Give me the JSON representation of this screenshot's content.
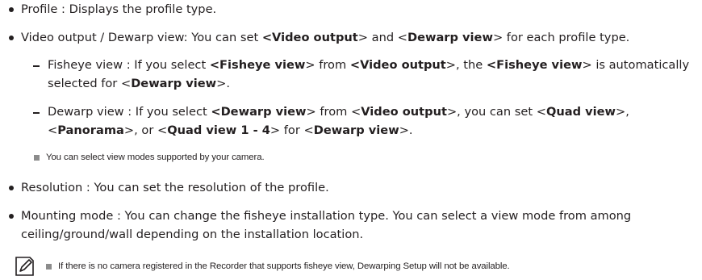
{
  "items": {
    "profile": {
      "label": "Profile",
      "text": " : Displays the profile type."
    },
    "video_output": {
      "label": "Video output / Dewarp view",
      "text1": ": You can set ",
      "b1": "<Video output",
      "text2": "> and <",
      "b2": "Dewarp view",
      "text3": "> for each profile type."
    },
    "fisheye": {
      "line1_a": "Fisheye view : If you select ",
      "line1_b": "<Fisheye view",
      "line1_c": "> from ",
      "line1_d": "<Video output",
      "line1_e": ">, the ",
      "line1_f": "<Fisheye view",
      "line1_g": "> is automatically",
      "line2_a": "selected for <",
      "line2_b": "Dewarp view",
      "line2_c": ">."
    },
    "dewarp": {
      "line1_a": "Dewarp view : If you select ",
      "line1_b": "<Dewarp view",
      "line1_c": "> from <",
      "line1_d": "Video output",
      "line1_e": ">, you can set <",
      "line1_f": "Quad view",
      "line1_g": ">,",
      "line2_a": "<",
      "line2_b": "Panorama",
      "line2_c": ">, or <",
      "line2_d": "Quad view 1 - 4",
      "line2_e": "> for <",
      "line2_f": "Dewarp view",
      "line2_g": ">."
    },
    "small_note": "You can select view modes supported by your camera.",
    "resolution": {
      "label": "Resolution",
      "text": " : You can set the resolution of the profile."
    },
    "mounting": {
      "line1": "Mounting mode : You can change the fisheye installation type. You can select a view mode from among",
      "line2": "ceiling/ground/wall depending on the installation location."
    }
  },
  "note": {
    "icon": "note-pencil-icon",
    "text": "If there is no camera registered in the Recorder that supports fisheye view, Dewarping Setup will not be available."
  }
}
